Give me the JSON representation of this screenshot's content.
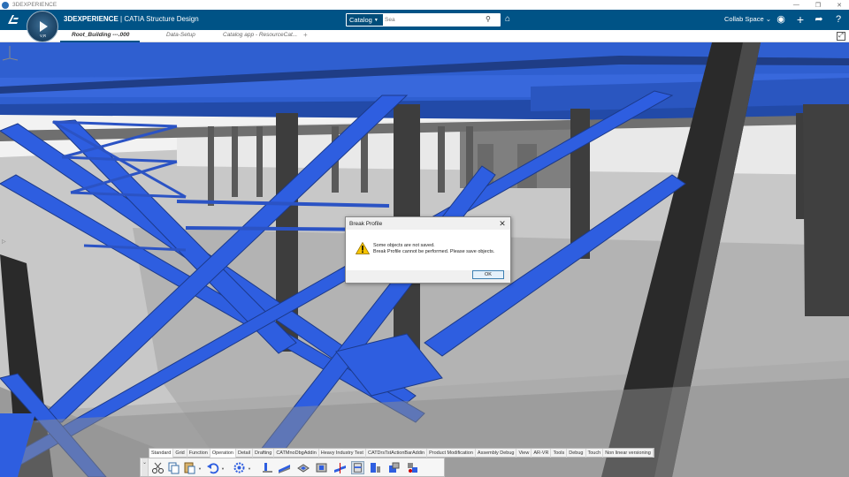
{
  "os_window": {
    "title": "3DEXPERIENCE",
    "controls": [
      "—",
      "❐",
      "✕"
    ]
  },
  "app_header": {
    "brand_bold": "3DEXPERIENCE",
    "brand_rest": " | CATIA Structure Design",
    "compass_version": "V,R",
    "search_scope": "Catalog",
    "search_placeholder": "Sea",
    "collab_space": "Collab Space",
    "accent_color": "#005386"
  },
  "tabs": [
    {
      "label": "Root_Building ---.000",
      "active": true
    },
    {
      "label": "Data-Setup",
      "active": false
    },
    {
      "label": "Catalog app - ResourceCat...",
      "active": false
    }
  ],
  "tab_add_label": "+",
  "dialog": {
    "title": "Break Profile",
    "close_label": "✕",
    "message_line1": "Some objects are not saved.",
    "message_line2": "Break Profile cannot be performed. Please save objects.",
    "ok_label": "OK",
    "icon": "warning-icon"
  },
  "action_bar": {
    "tabs": [
      {
        "label": "Standard",
        "active": true
      },
      {
        "label": "Grid"
      },
      {
        "label": "Function"
      },
      {
        "label": "Operation",
        "active": true
      },
      {
        "label": "Detail"
      },
      {
        "label": "Drafting"
      },
      {
        "label": "CATMnoDbgAddin"
      },
      {
        "label": "Heavy Industry Test"
      },
      {
        "label": "CATDrsTstActionBarAddin"
      },
      {
        "label": "Product Modification"
      },
      {
        "label": "Assembly Debug"
      },
      {
        "label": "View"
      },
      {
        "label": "AR-VR"
      },
      {
        "label": "Tools"
      },
      {
        "label": "Debug"
      },
      {
        "label": "Touch"
      },
      {
        "label": "Non linear versioning"
      }
    ],
    "icons": [
      "scissors-icon",
      "copy-icon",
      "paste-icon",
      "undo-icon",
      "settings-gear-icon",
      "profile-icon",
      "stiffener-icon",
      "plate-icon",
      "opening-icon",
      "break-profile-icon",
      "split-icon",
      "split-plate-icon",
      "add-material-icon",
      "attach-icon"
    ]
  }
}
